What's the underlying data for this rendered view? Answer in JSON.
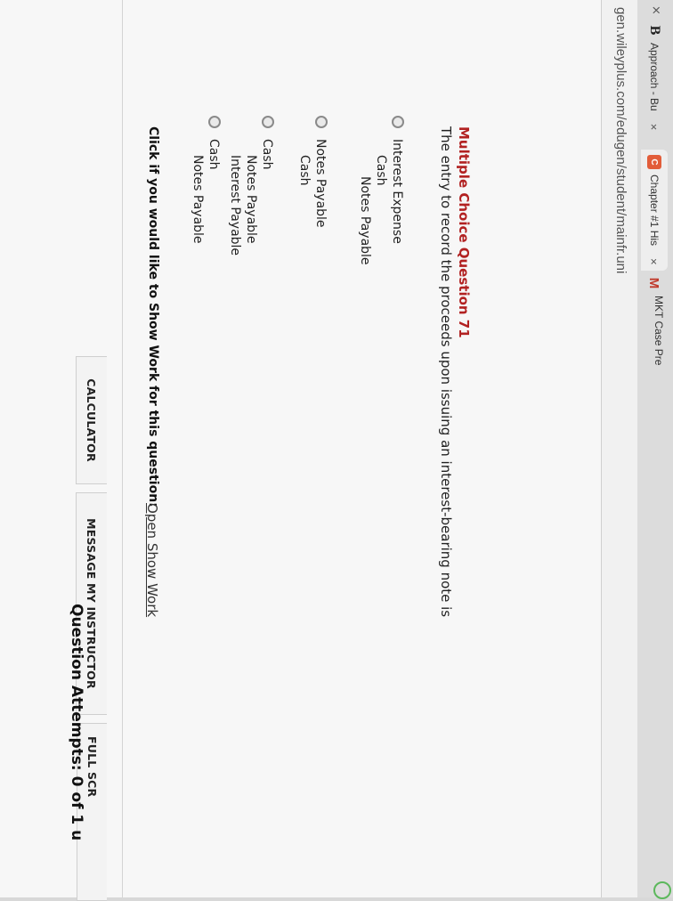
{
  "browser": {
    "tabs": [
      {
        "label": "Approach - Bu",
        "icon": "B"
      },
      {
        "label": "Chapter #1 His",
        "icon": "C"
      },
      {
        "label": "MKT Case Pre",
        "icon": "M"
      }
    ],
    "close_glyph": "×",
    "url": "gen.wileyplus.com/edugen/student/mainfr.uni"
  },
  "toolbar": {
    "calculator": "CALCULATOR",
    "message": "MESSAGE MY INSTRUCTOR",
    "fullscreen": "FULL SCR"
  },
  "question": {
    "title": "Multiple Choice Question 71",
    "text": "The entry to record the proceeds upon issuing an interest-bearing note is",
    "options": [
      {
        "lines": [
          "Interest Expense",
          "Cash",
          "Notes Payable"
        ]
      },
      {
        "lines": [
          "Notes Payable",
          "Cash"
        ]
      },
      {
        "lines": [
          "Cash",
          "Notes Payable",
          "Interest Payable"
        ]
      },
      {
        "lines": [
          "Cash",
          "Notes Payable"
        ]
      }
    ]
  },
  "show_work": {
    "label": "Click if you would like to Show Work for this question:",
    "link": "Open Show Work"
  },
  "attempts": "Question Attempts: 0 of 1 u"
}
